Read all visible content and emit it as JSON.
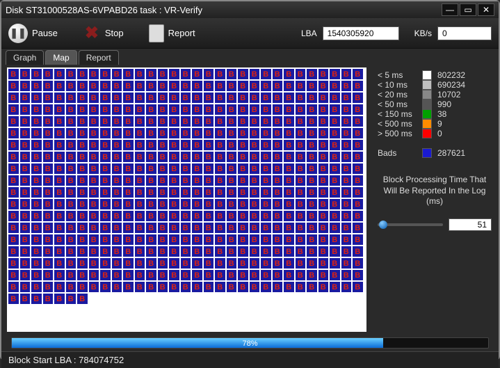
{
  "window": {
    "title": "Disk ST31000528AS-6VPABD26   task : VR-Verify"
  },
  "toolbar": {
    "pause": "Pause",
    "stop": "Stop",
    "report": "Report",
    "lba_label": "LBA",
    "lba_value": "1540305920",
    "kbs_label": "KB/s",
    "kbs_value": "0"
  },
  "tabs": {
    "items": [
      "Graph",
      "Map",
      "Report"
    ],
    "active": 1
  },
  "map": {
    "cols": 31,
    "rows": 20,
    "last_row_cols": 7,
    "cell_glyph": "B"
  },
  "legend": {
    "rows": [
      {
        "label": "< 5 ms",
        "color": "#ffffff",
        "count": "802232"
      },
      {
        "label": "< 10 ms",
        "color": "#c0c0c0",
        "count": "690234"
      },
      {
        "label": "< 20 ms",
        "color": "#888888",
        "count": "10702"
      },
      {
        "label": "< 50 ms",
        "color": "#555555",
        "count": "990"
      },
      {
        "label": "< 150 ms",
        "color": "#00a000",
        "count": "38"
      },
      {
        "label": "< 500 ms",
        "color": "#ff8c00",
        "count": "9"
      },
      {
        "label": "> 500 ms",
        "color": "#ff0000",
        "count": "0"
      },
      {
        "label": "Bads",
        "color": "#1a1ad0",
        "count": "287621"
      }
    ],
    "hint_line1": "Block Processing Time That",
    "hint_line2": "Will Be Reported In the Log (ms)",
    "slider_value": "51"
  },
  "progress": {
    "percent": 78,
    "label": "78%"
  },
  "status": {
    "text": "Block Start LBA : 784074752"
  }
}
